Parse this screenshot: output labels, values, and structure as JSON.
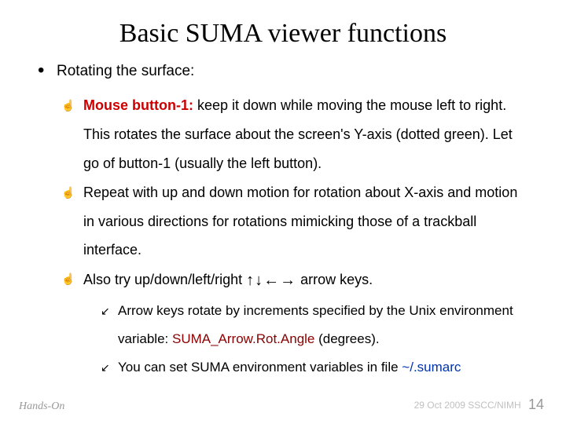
{
  "title": "Basic SUMA viewer functions",
  "bullet1": {
    "label": "Rotating the surface:"
  },
  "sub": {
    "item1_boldred": "Mouse button-1:",
    "item1_rest": " keep it down while moving the mouse left to right. This rotates the surface about the screen's Y-axis (dotted green). Let go of button-1 (usually the left button).",
    "item2": "Repeat with up and down motion for rotation about X-axis and motion in various directions for rotations mimicking those of a trackball interface.",
    "item3_pre": "Also try up/down/left/right ",
    "item3_arrows": "↑↓←→",
    "item3_post": " arrow keys."
  },
  "subsub": {
    "a_pre": "Arrow keys rotate by increments specified by the Unix environment variable: ",
    "a_var": "SUMA_Arrow.Rot.Angle",
    "a_post": " (degrees).",
    "b_pre": "You can set SUMA environment variables in file ",
    "b_file": "~/.sumarc"
  },
  "footer": {
    "left": "Hands-On",
    "right_date": "29 Oct 2009 SSCC/NIMH",
    "right_page": "14"
  }
}
